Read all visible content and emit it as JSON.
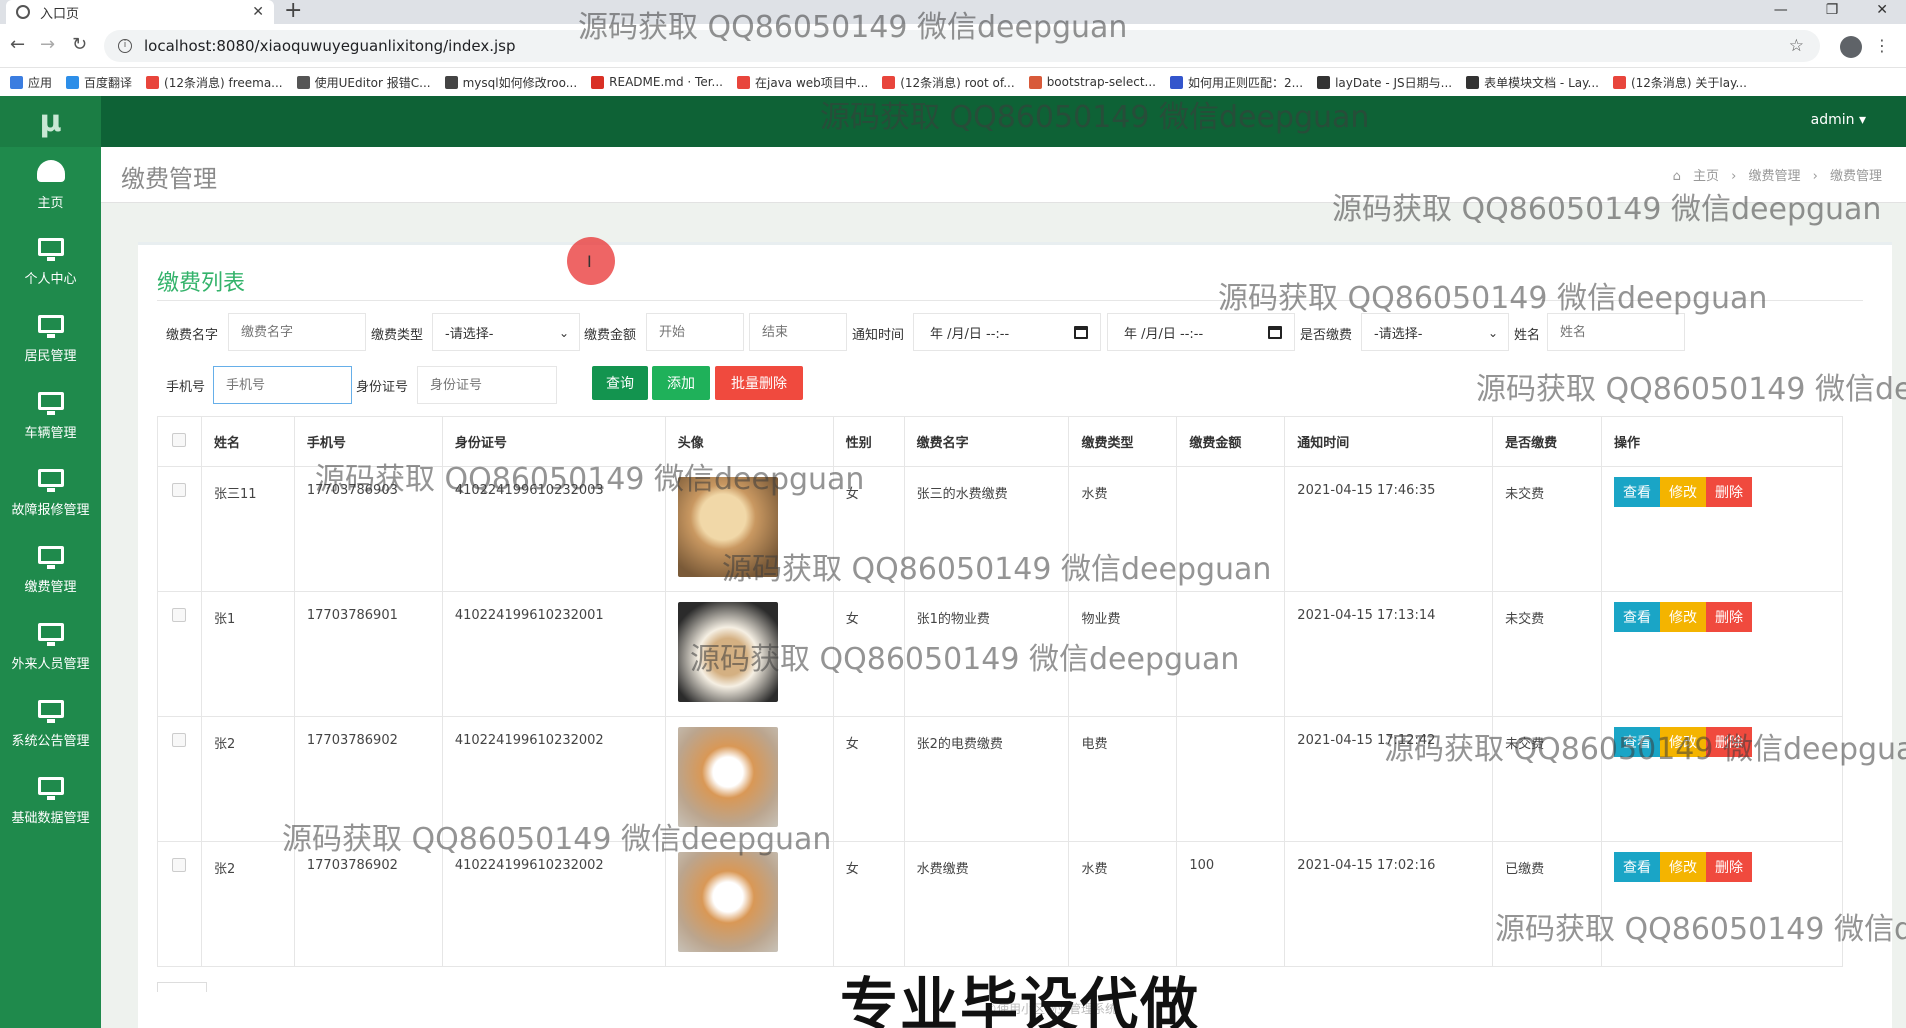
{
  "browser": {
    "tab_title": "入口页",
    "url": "localhost:8080/xiaoquwuyeguanlixitong/index.jsp",
    "bookmarks": [
      "应用",
      "百度翻译",
      "(12条消息) freema...",
      "使用UEditor 报错C...",
      "mysql如何修改roo...",
      "README.md · Ter...",
      "在java web项目中...",
      "(12条消息) root of...",
      "bootstrap-select...",
      "如何用正则匹配：2...",
      "layDate - JS日期与...",
      "表单模块文档 - Lay...",
      "(12条消息) 关于lay..."
    ]
  },
  "sidebar": {
    "logo": "μ",
    "items": [
      {
        "label": "主页",
        "icon": "dashboard-icon"
      },
      {
        "label": "个人中心",
        "icon": "monitor-icon"
      },
      {
        "label": "居民管理",
        "icon": "monitor-icon"
      },
      {
        "label": "车辆管理",
        "icon": "monitor-icon"
      },
      {
        "label": "故障报修管理",
        "icon": "monitor-icon"
      },
      {
        "label": "缴费管理",
        "icon": "monitor-icon"
      },
      {
        "label": "外来人员管理",
        "icon": "monitor-icon"
      },
      {
        "label": "系统公告管理",
        "icon": "monitor-icon"
      },
      {
        "label": "基础数据管理",
        "icon": "monitor-icon"
      }
    ]
  },
  "topbar": {
    "user": "admin ▾"
  },
  "page": {
    "title": "缴费管理",
    "breadcrumb": [
      "主页",
      "缴费管理",
      "缴费管理"
    ]
  },
  "card": {
    "title": "缴费列表"
  },
  "filters": {
    "fee_name_label": "缴费名字",
    "fee_name_placeholder": "缴费名字",
    "fee_type_label": "缴费类型",
    "fee_type_value": "-请选择-",
    "amount_label": "缴费金额",
    "amount_start": "开始",
    "amount_end": "结束",
    "notice_time_label": "通知时间",
    "date_from": "年 /月/日 --:--",
    "date_to": "年 /月/日 --:--",
    "paid_label": "是否缴费",
    "paid_value": "-请选择-",
    "name_label": "姓名",
    "name_placeholder": "姓名",
    "phone_label": "手机号",
    "phone_placeholder": "手机号",
    "id_label": "身份证号",
    "id_placeholder": "身份证号"
  },
  "buttons": {
    "query": "查询",
    "add": "添加",
    "batch_delete": "批量删除"
  },
  "table": {
    "headers": [
      "姓名",
      "手机号",
      "身份证号",
      "头像",
      "性别",
      "缴费名字",
      "缴费类型",
      "缴费金额",
      "通知时间",
      "是否缴费",
      "操作"
    ],
    "actions": {
      "view": "查看",
      "edit": "修改",
      "delete": "删除"
    },
    "rows": [
      {
        "name": "张三11",
        "phone": "17703786903",
        "id_no": "410224199610232003",
        "gender": "女",
        "fee_name": "张三的水费缴费",
        "fee_type": "水费",
        "amount": "",
        "notice_time": "2021-04-15 17:46:35",
        "paid": "未交费"
      },
      {
        "name": "张1",
        "phone": "17703786901",
        "id_no": "410224199610232001",
        "gender": "女",
        "fee_name": "张1的物业费",
        "fee_type": "物业费",
        "amount": "",
        "notice_time": "2021-04-15 17:13:14",
        "paid": "未交费"
      },
      {
        "name": "张2",
        "phone": "17703786902",
        "id_no": "410224199610232002",
        "gender": "女",
        "fee_name": "张2的电费缴费",
        "fee_type": "电费",
        "amount": "",
        "notice_time": "2021-04-15 17:12:42",
        "paid": "未交费"
      },
      {
        "name": "张2",
        "phone": "17703786902",
        "id_no": "410224199610232002",
        "gender": "女",
        "fee_name": "水费缴费",
        "fee_type": "水费",
        "amount": "100",
        "notice_time": "2021-04-15 17:02:16",
        "paid": "已缴费"
      }
    ]
  },
  "overlay": {
    "watermark": "源码获取 QQ86050149 微信deepguan",
    "watermark_cut1": "源码获取 QQ86050149 微信de",
    "watermark_cut2": "源码获取 QQ86050149 微信deepgua",
    "watermark_cut3": "源码获取 QQ86050149 微信d",
    "banner": "专业毕设代做",
    "footer": "©使用小区物业管理系统"
  }
}
